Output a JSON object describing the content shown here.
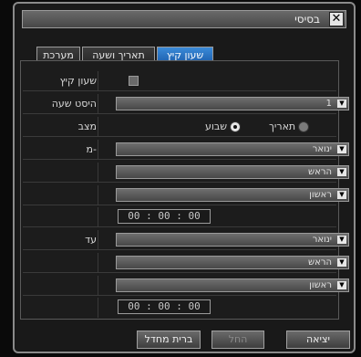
{
  "window": {
    "title": "בסיסי",
    "close_icon": "close-icon"
  },
  "tabs": [
    {
      "label": "מערכת",
      "active": false
    },
    {
      "label": "תאריך ושעה",
      "active": false
    },
    {
      "label": "שעון קיץ",
      "active": true
    }
  ],
  "dst": {
    "enable_label": "שעון קיץ",
    "enable_checked": false,
    "offset_label": "היסט שעה",
    "offset_value": "1",
    "mode_label": "מצב",
    "mode_options": {
      "week": "שבוע",
      "date": "תאריך"
    },
    "mode_selected": "week",
    "from_label": "מ-",
    "from": {
      "month": "ינואר",
      "week": "הראש",
      "day": "ראשון",
      "time": "00 : 00 : 00"
    },
    "to_label": "עד",
    "to": {
      "month": "ינואר",
      "week": "הראש",
      "day": "ראשון",
      "time": "00 : 00 : 00"
    }
  },
  "buttons": {
    "default": "ברית מחדל",
    "apply": "החל",
    "exit": "יציאה"
  },
  "colors": {
    "active_tab": "#2a72c0",
    "background": "#191919"
  }
}
